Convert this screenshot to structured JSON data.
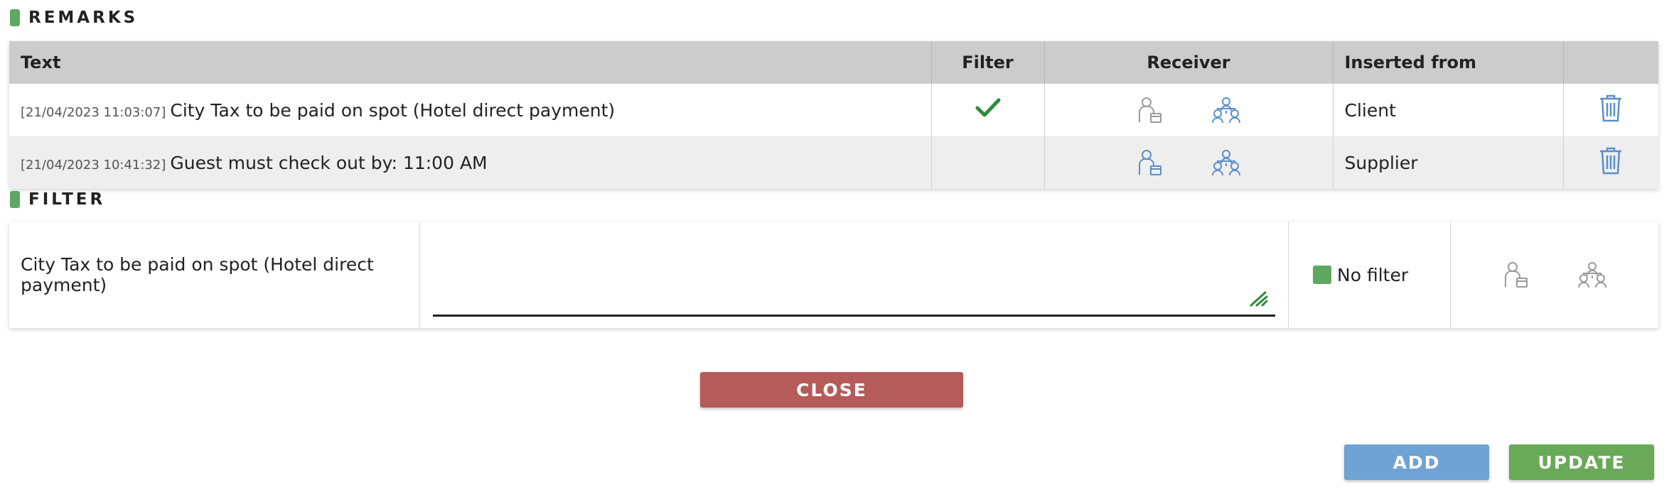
{
  "remarks": {
    "title": "REMARKS",
    "columns": [
      "Text",
      "Filter",
      "Receiver",
      "Inserted from",
      ""
    ],
    "rows": [
      {
        "timestamp": "[21/04/2023 11:03:07]",
        "text": "City Tax to be paid on spot (Hotel direct payment)",
        "filter_checked": true,
        "receiver_client_active": false,
        "receiver_group_active": true,
        "inserted_from": "Client"
      },
      {
        "timestamp": "[21/04/2023 10:41:32]",
        "text": "Guest must check out by: 11:00 AM",
        "filter_checked": false,
        "receiver_client_active": true,
        "receiver_group_active": true,
        "inserted_from": "Supplier"
      }
    ]
  },
  "filter": {
    "title": "FILTER",
    "selected_text": "City Tax to be paid on spot (Hotel direct payment)",
    "input_value": "",
    "no_filter_label": "No filter"
  },
  "buttons": {
    "close": "CLOSE",
    "add": "ADD",
    "update": "UPDATE"
  },
  "colors": {
    "accent_green": "#5fa85f",
    "check_green": "#2e8b3a",
    "icon_blue": "#5b8fc9",
    "icon_gray": "#9a9a9a",
    "close_red": "#b55b59",
    "add_blue": "#6fa3d3",
    "update_green": "#69a958"
  },
  "icons": {
    "client": "client-receiver-icon",
    "group": "group-receiver-icon",
    "trash": "trash-icon",
    "check": "check-icon"
  }
}
